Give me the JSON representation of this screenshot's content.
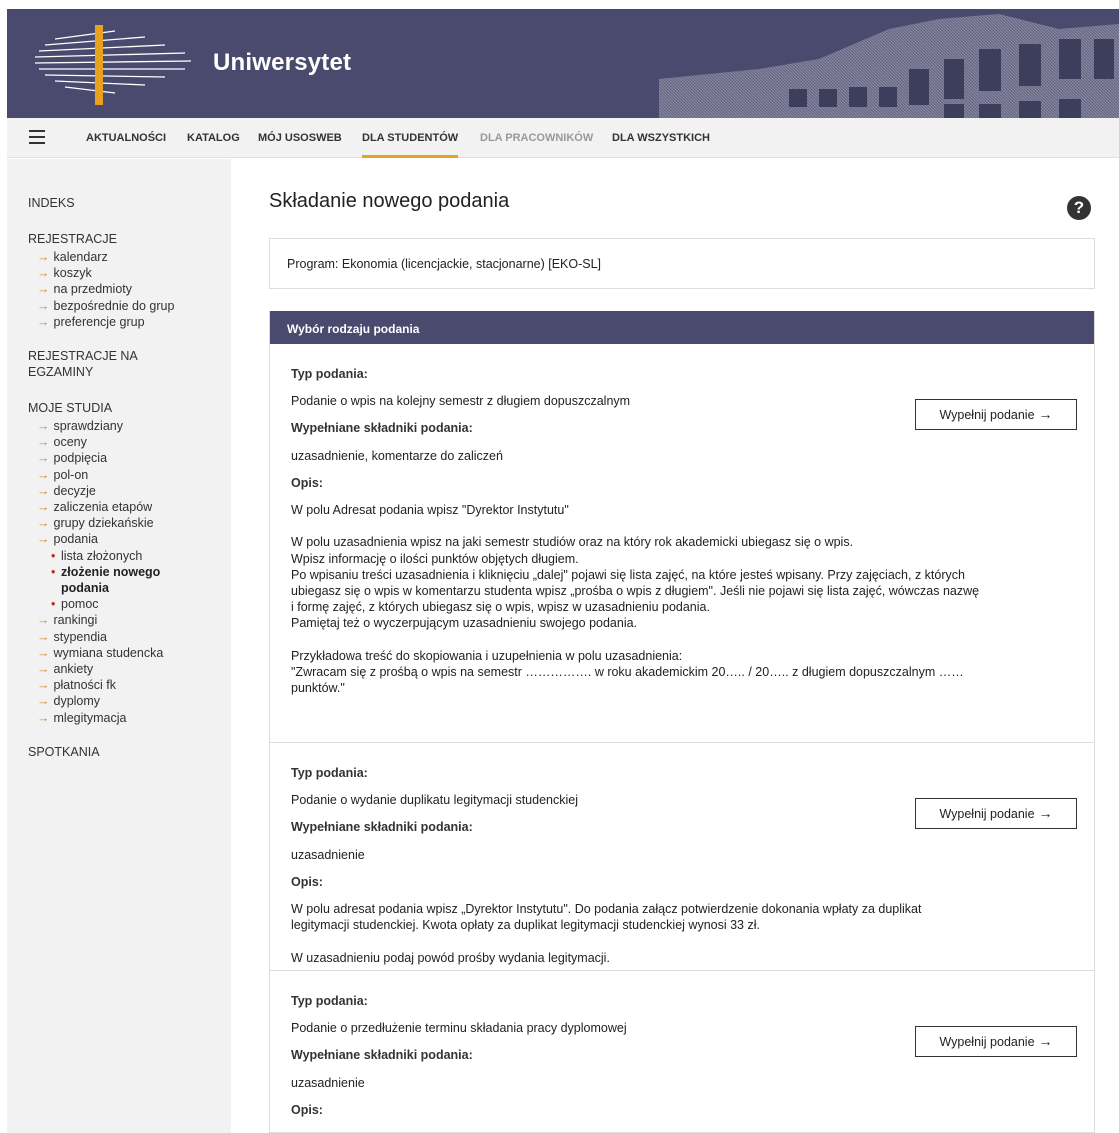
{
  "header": {
    "brand": "Uniwersytet"
  },
  "topnav": {
    "items": [
      {
        "label": "AKTUALNOŚCI"
      },
      {
        "label": "KATALOG"
      },
      {
        "label": "MÓJ USOSWEB"
      },
      {
        "label": "DLA STUDENTÓW"
      },
      {
        "label": "DLA PRACOWNIKÓW"
      },
      {
        "label": "DLA WSZYSTKICH"
      }
    ]
  },
  "sidebar": {
    "indeks": "INDEKS",
    "rejestracje": "REJESTRACJE",
    "rejestracje_items": [
      "kalendarz",
      "koszyk",
      "na przedmioty",
      "bezpośrednie do grup",
      "preferencje grup"
    ],
    "rejestracje_na_egz_1": "REJESTRACJE NA",
    "rejestracje_na_egz_2": "EGZAMINY",
    "moje_studia": "MOJE STUDIA",
    "moje_items_a": [
      "sprawdziany",
      "oceny",
      "podpięcia",
      "pol-on",
      "decyzje",
      "zaliczenia etapów",
      "grupy dziekańskie",
      "podania"
    ],
    "podania_sub": [
      "lista złożonych",
      "złożenie nowego",
      "podania",
      "pomoc"
    ],
    "moje_items_b": [
      "rankingi",
      "stypendia",
      "wymiana studencka",
      "ankiety",
      "płatności fk",
      "dyplomy",
      "mlegitymacja"
    ],
    "spotkania": "SPOTKANIA"
  },
  "main": {
    "title": "Składanie nowego podania",
    "program_label": "Program:",
    "program_value": "Ekonomia (licencjackie, stacjonarne) [EKO-SL]",
    "panel_title": "Wybór rodzaju podania",
    "labels": {
      "typ": "Typ podania:",
      "skladniki": "Wypełniane składniki podania:",
      "opis": "Opis:",
      "btn": "Wypełnij podanie"
    },
    "entries": [
      {
        "typ": "Podanie o wpis na kolejny semestr z długiem dopuszczalnym",
        "skladniki": "uzasadnienie,  komentarze do zaliczeń",
        "opis": "W polu Adresat podania wpisz \"Dyrektor Instytutu\"\n\nW polu uzasadnienia wpisz na jaki semestr studiów oraz na który rok akademicki ubiegasz się o wpis.\nWpisz informację o ilości punktów objętych długiem.\nPo wpisaniu treści uzasadnienia i kliknięciu „dalej\" pojawi się lista zajęć, na które jesteś wpisany. Przy zajęciach, z których\nubiegasz się o wpis w komentarzu studenta wpisz „prośba o wpis z długiem\". Jeśli nie pojawi się lista zajęć, wówczas nazwę\ni formę zajęć, z których ubiegasz się o wpis, wpisz w uzasadnieniu podania.\nPamiętaj też o wyczerpującym uzasadnieniu swojego podania.\n\nPrzykładowa treść do skopiowania i uzupełnienia w polu uzasadnienia:\n\"Zwracam się z prośbą o wpis na semestr ……………. w roku akademickim 20….. / 20….. z długiem dopuszczalnym ……\npunktów.\""
      },
      {
        "typ": "Podanie o wydanie duplikatu legitymacji studenckiej",
        "skladniki": "uzasadnienie",
        "opis": "W polu adresat podania wpisz „Dyrektor Instytutu\". Do podania załącz potwierdzenie dokonania wpłaty za duplikat\nlegitymacji studenckiej. Kwota opłaty za duplikat legitymacji studenckiej wynosi 33 zł.\n\nW uzasadnieniu podaj powód prośby wydania legitymacji."
      },
      {
        "typ": "Podanie o przedłużenie terminu składania pracy dyplomowej",
        "skladniki": "uzasadnienie",
        "opis": ""
      }
    ]
  }
}
